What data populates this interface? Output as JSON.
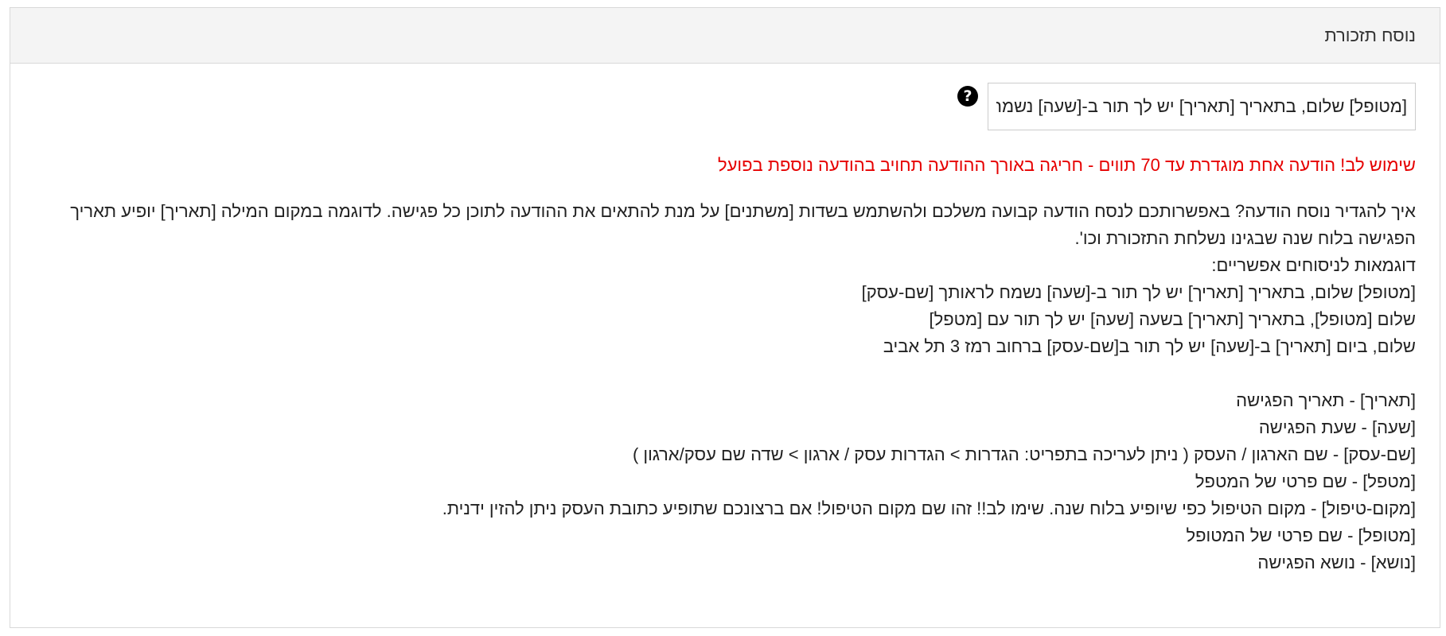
{
  "panel": {
    "title": "נוסח תזכורת"
  },
  "template_input": {
    "value": "[מטופל] שלום, בתאריך [תאריך] יש לך תור ב-[שעה] נשמח לראותך [שם-עסק]"
  },
  "help_icon": {
    "glyph": "?",
    "icon_name": "question-circle-icon"
  },
  "warning": {
    "text": "שימוש לב! הודעה אחת מוגדרת עד 70 תווים - חריגה באורך ההודעה תחויב בהודעה נוספת בפועל",
    "color": "#e60000"
  },
  "instructions": {
    "intro_line1": "איך להגדיר נוסח הודעה? באפשרותכם לנסח הודעה קבועה משלכם ולהשתמש בשדות [משתנים] על מנת להתאים את ההודעה לתוכן כל פגישה. לדוגמה במקום המילה [תאריך] יופיע תאריך",
    "intro_line2": "הפגישה בלוח שנה שבגינו נשלחת התזכורת וכו'.",
    "examples_title": "דוגמאות לניסוחים אפשריים:",
    "examples": [
      "[מטופל] שלום, בתאריך [תאריך] יש לך תור ב-[שעה] נשמח לראותך [שם-עסק]",
      "שלום [מטופל], בתאריך [תאריך] בשעה [שעה] יש לך תור עם [מטפל]",
      "שלום, ביום [תאריך] ב-[שעה] יש לך תור ב[שם-עסק] ברחוב רמז 3 תל אביב"
    ],
    "variables": [
      "[תאריך] - תאריך הפגישה",
      "[שעה] - שעת הפגישה",
      "[שם-עסק] - שם הארגון / העסק ( ניתן לעריכה בתפריט: הגדרות > הגדרות עסק / ארגון > שדה שם עסק/ארגון )",
      "[מטפל] - שם פרטי של המטפל",
      "[מקום-טיפול] - מקום הטיפול כפי שיופיע בלוח שנה. שימו לב!! זהו שם מקום הטיפול! אם ברצונכם שתופיע כתובת העסק ניתן להזין ידנית.",
      "[מטופל] - שם פרטי של המטופל",
      "[נושא] - נושא הפגישה"
    ]
  }
}
